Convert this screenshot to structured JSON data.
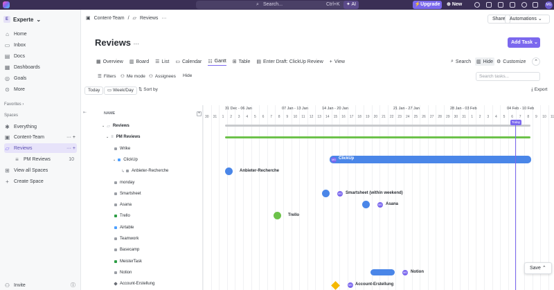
{
  "topbar": {
    "search_placeholder": "Search...",
    "search_shortcut": "Ctrl+K",
    "ai_label": "AI",
    "upgrade_label": "Upgrade",
    "new_label": "New",
    "avatar_initials": "MG"
  },
  "sidebar": {
    "workspace": "Experte",
    "workspace_badge": "E",
    "nav": [
      {
        "label": "Home",
        "icon": "home-icon"
      },
      {
        "label": "Inbox",
        "icon": "inbox-icon"
      },
      {
        "label": "Docs",
        "icon": "docs-icon"
      },
      {
        "label": "Dashboards",
        "icon": "dashboard-icon"
      },
      {
        "label": "Goals",
        "icon": "goals-icon"
      },
      {
        "label": "More",
        "icon": "more-icon"
      }
    ],
    "favorites_label": "Favorites",
    "spaces_label": "Spaces",
    "spaces": [
      {
        "label": "Everything"
      },
      {
        "label": "Content-Team"
      },
      {
        "label": "Reviews"
      },
      {
        "label": "PM Reviews",
        "count": "10"
      },
      {
        "label": "View all Spaces"
      },
      {
        "label": "Create Space"
      }
    ],
    "invite_label": "Invite"
  },
  "header": {
    "crumb_space": "Content-Team",
    "crumb_sep": "/",
    "crumb_folder": "Reviews",
    "share": "Share",
    "automations": "Automations",
    "title": "Reviews",
    "add_task": "Add Task"
  },
  "tabs": [
    {
      "label": "Overview"
    },
    {
      "label": "Board"
    },
    {
      "label": "List"
    },
    {
      "label": "Calendar"
    },
    {
      "label": "Gantt"
    },
    {
      "label": "Table"
    },
    {
      "label": "Enter Draft: ClickUp Review"
    },
    {
      "label": "View"
    }
  ],
  "tools": {
    "search": "Search",
    "hide": "Hide",
    "customize": "Customize",
    "filters": "Filters",
    "me_mode": "Me mode",
    "assignees": "Assignees",
    "hide2": "Hide",
    "search_tasks": "Search tasks..."
  },
  "controls": {
    "today": "Today",
    "week_day": "Week/Day",
    "sort_by": "Sort by",
    "export": "Export"
  },
  "gantt": {
    "name_header": "NAME",
    "weeks": [
      "31 Dec - 06 Jan",
      "07 Jan - 13 Jan",
      "14 Jan - 20 Jan",
      "21 Jan - 27 Jan",
      "28 Jan - 03 Feb",
      "04 Feb - 10 Feb"
    ],
    "days": [
      "30",
      "31",
      "1",
      "2",
      "3",
      "4",
      "5",
      "6",
      "7",
      "8",
      "9",
      "10",
      "11",
      "12",
      "13",
      "14",
      "15",
      "16",
      "17",
      "18",
      "19",
      "20",
      "21",
      "22",
      "23",
      "24",
      "25",
      "26",
      "27",
      "28",
      "29",
      "30",
      "31",
      "1",
      "2",
      "3",
      "4",
      "5",
      "6",
      "7",
      "8",
      "9",
      "10",
      "11"
    ],
    "today_label": "Today",
    "rows": [
      {
        "label": "Reviews",
        "color": "#b0b4ba"
      },
      {
        "label": "PM Reviews",
        "color": "#b0b4ba"
      },
      {
        "label": "Wrike",
        "color": "#9a9ea5"
      },
      {
        "label": "ClickUp",
        "color": "#4da0ff"
      },
      {
        "label": "Anbieter-Recherche",
        "color": "#9a9ea5"
      },
      {
        "label": "monday",
        "color": "#9a9ea5"
      },
      {
        "label": "Smartsheet",
        "color": "#9a9ea5"
      },
      {
        "label": "Asana",
        "color": "#9a9ea5"
      },
      {
        "label": "Trello",
        "color": "#2e9e45"
      },
      {
        "label": "Airtable",
        "color": "#4da0ff"
      },
      {
        "label": "Teamwork",
        "color": "#9a9ea5"
      },
      {
        "label": "Basecamp",
        "color": "#9a9ea5"
      },
      {
        "label": "MeisterTask",
        "color": "#2e9e45"
      },
      {
        "label": "Notion",
        "color": "#9a9ea5"
      },
      {
        "label": "Account-Erstellung",
        "color": "#6b6f76"
      }
    ],
    "bar_labels": {
      "clickup": "ClickUp",
      "anbieter": "Anbieter-Recherche",
      "smartsheet": "Smartsheet (within weekend)",
      "asana": "Asana",
      "trello": "Trello",
      "notion": "Notion",
      "account": "Account-Erstellung"
    },
    "assignee_initials": "MG"
  },
  "save_label": "Save",
  "colors": {
    "accent": "#7b68ee",
    "blue_bar": "#4a86e8",
    "green": "#6cc24a",
    "gold": "#f5b800"
  }
}
